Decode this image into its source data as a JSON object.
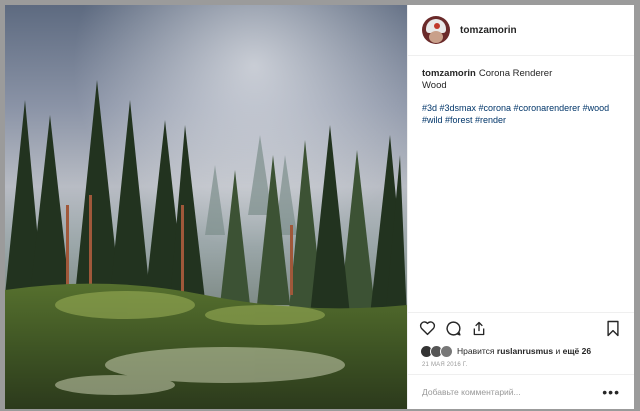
{
  "post": {
    "username": "tomzamorin",
    "caption_text": "Corona Renderer",
    "caption_line2": "Wood",
    "hashtags": "#3d #3dsmax #corona #coronarenderer #wood #wild #forest #render",
    "likes_prefix": "Нравится",
    "likes_user": "ruslanrusmus",
    "likes_mid": "и",
    "likes_more": "ещё 26",
    "date": "21 МАЯ 2016 Г.",
    "comment_placeholder": "Добавьте комментарий...",
    "more_label": "•••"
  },
  "icons": {
    "like": "heart-icon",
    "comment": "comment-icon",
    "share": "share-icon",
    "save": "bookmark-icon"
  },
  "colors": {
    "hashtag": "#003569",
    "text": "#262626",
    "muted": "#999999"
  }
}
